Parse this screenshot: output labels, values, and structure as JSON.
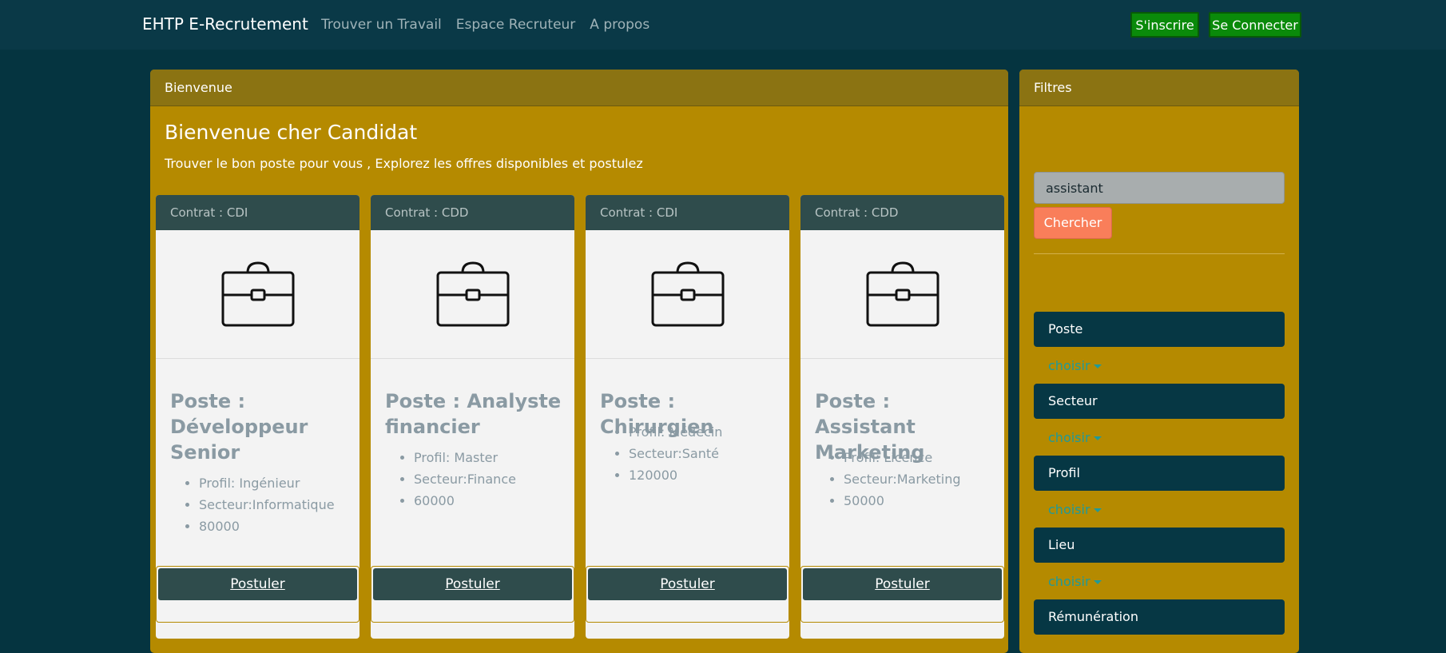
{
  "navbar": {
    "brand": "EHTP E-Recrutement",
    "links": [
      "Trouver un Travail",
      "Espace Recruteur",
      "A propos"
    ],
    "signup_label": "S'inscrire",
    "login_label": "Se Connecter"
  },
  "main": {
    "header": "Bienvenue",
    "title": "Bienvenue cher Candidat",
    "subtitle": "Trouver le bon poste pour vous , Explorez les offres disponibles et postulez",
    "cards": [
      {
        "contract": "Contrat : CDI",
        "title": "Poste : Développeur Senior",
        "profile": "Profil: Ingénieur",
        "sector": "Secteur:Informatique",
        "salary": "80000",
        "apply_label": "Postuler"
      },
      {
        "contract": "Contrat : CDD",
        "title": "Poste : Analyste financier",
        "profile": "Profil: Master",
        "sector": "Secteur:Finance",
        "salary": "60000",
        "apply_label": "Postuler"
      },
      {
        "contract": "Contrat : CDI",
        "title": "Poste : Chirurgien",
        "profile": "Profil: Médecin",
        "sector": "Secteur:Santé",
        "salary": "120000",
        "apply_label": "Postuler"
      },
      {
        "contract": "Contrat : CDD",
        "title": "Poste : Assistant Marketing",
        "profile": "Profil: Licence",
        "sector": "Secteur:Marketing",
        "salary": "50000",
        "apply_label": "Postuler"
      }
    ]
  },
  "filters": {
    "header": "Filtres",
    "search_value": "assistant",
    "search_button": "Chercher",
    "groups": [
      {
        "label": "Poste",
        "dropdown": "choisir"
      },
      {
        "label": "Secteur",
        "dropdown": "choisir"
      },
      {
        "label": "Profil",
        "dropdown": "choisir"
      },
      {
        "label": "Lieu",
        "dropdown": "choisir"
      },
      {
        "label": "Rémunération"
      }
    ]
  },
  "colors": {
    "background": "#053440",
    "panel": "#b58a00",
    "panel_header": "#8b7312",
    "card_header": "#2f4c4c",
    "nav_button": "#0a8a0a",
    "search_button": "#f97e5a"
  },
  "icons": {
    "card_image": "briefcase-icon"
  }
}
